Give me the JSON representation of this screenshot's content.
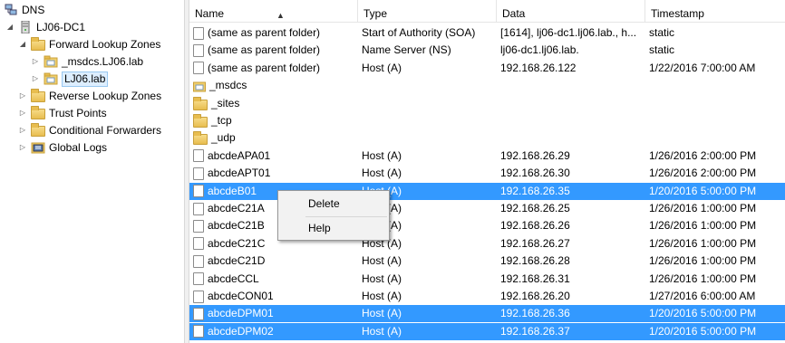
{
  "tree": [
    {
      "label": "DNS",
      "expander": "",
      "icon": "dns-manager-icon"
    },
    {
      "label": "LJ06-DC1",
      "expander": "◢",
      "icon": "server-icon"
    },
    {
      "label": "Forward Lookup Zones",
      "expander": "◢",
      "icon": "folder-icon"
    },
    {
      "label": "_msdcs.LJ06.lab",
      "expander": "▷",
      "icon": "zone-icon"
    },
    {
      "label": "LJ06.lab",
      "expander": "▷",
      "icon": "zone-icon",
      "selected": true
    },
    {
      "label": "Reverse Lookup Zones",
      "expander": "▷",
      "icon": "folder-icon"
    },
    {
      "label": "Trust Points",
      "expander": "▷",
      "icon": "folder-icon"
    },
    {
      "label": "Conditional Forwarders",
      "expander": "▷",
      "icon": "folder-icon"
    },
    {
      "label": "Global Logs",
      "expander": "▷",
      "icon": "log-icon"
    }
  ],
  "columns": {
    "name": "Name",
    "type": "Type",
    "data": "Data",
    "timestamp": "Timestamp"
  },
  "rows": [
    {
      "name": "(same as parent folder)",
      "type": "Start of Authority (SOA)",
      "data": "[1614], lj06-dc1.lj06.lab., h...",
      "timestamp": "static",
      "icon": "record-icon"
    },
    {
      "name": "(same as parent folder)",
      "type": "Name Server (NS)",
      "data": "lj06-dc1.lj06.lab.",
      "timestamp": "static",
      "icon": "record-icon"
    },
    {
      "name": "(same as parent folder)",
      "type": "Host (A)",
      "data": "192.168.26.122",
      "timestamp": "1/22/2016 7:00:00 AM",
      "icon": "record-icon"
    },
    {
      "name": "_msdcs",
      "type": "",
      "data": "",
      "timestamp": "",
      "icon": "zone-icon"
    },
    {
      "name": "_sites",
      "type": "",
      "data": "",
      "timestamp": "",
      "icon": "folder-icon"
    },
    {
      "name": "_tcp",
      "type": "",
      "data": "",
      "timestamp": "",
      "icon": "folder-icon"
    },
    {
      "name": "_udp",
      "type": "",
      "data": "",
      "timestamp": "",
      "icon": "folder-icon"
    },
    {
      "name": "abcdeAPA01",
      "type": "Host (A)",
      "data": "192.168.26.29",
      "timestamp": "1/26/2016 2:00:00 PM",
      "icon": "record-icon"
    },
    {
      "name": "abcdeAPT01",
      "type": "Host (A)",
      "data": "192.168.26.30",
      "timestamp": "1/26/2016 2:00:00 PM",
      "icon": "record-icon"
    },
    {
      "name": "abcdeB01",
      "type": "Host (A)",
      "data": "192.168.26.35",
      "timestamp": "1/20/2016 5:00:00 PM",
      "icon": "record-icon",
      "selected": true
    },
    {
      "name": "abcdeC21A",
      "type": "Host (A)",
      "data": "192.168.26.25",
      "timestamp": "1/26/2016 1:00:00 PM",
      "icon": "record-icon"
    },
    {
      "name": "abcdeC21B",
      "type": "Host (A)",
      "data": "192.168.26.26",
      "timestamp": "1/26/2016 1:00:00 PM",
      "icon": "record-icon"
    },
    {
      "name": "abcdeC21C",
      "type": "Host (A)",
      "data": "192.168.26.27",
      "timestamp": "1/26/2016 1:00:00 PM",
      "icon": "record-icon"
    },
    {
      "name": "abcdeC21D",
      "type": "Host (A)",
      "data": "192.168.26.28",
      "timestamp": "1/26/2016 1:00:00 PM",
      "icon": "record-icon"
    },
    {
      "name": "abcdeCCL",
      "type": "Host (A)",
      "data": "192.168.26.31",
      "timestamp": "1/26/2016 1:00:00 PM",
      "icon": "record-icon"
    },
    {
      "name": "abcdeCON01",
      "type": "Host (A)",
      "data": "192.168.26.20",
      "timestamp": "1/27/2016 6:00:00 AM",
      "icon": "record-icon"
    },
    {
      "name": "abcdeDPM01",
      "type": "Host (A)",
      "data": "192.168.26.36",
      "timestamp": "1/20/2016 5:00:00 PM",
      "icon": "record-icon",
      "selected": true
    },
    {
      "name": "abcdeDPM02",
      "type": "Host (A)",
      "data": "192.168.26.37",
      "timestamp": "1/20/2016 5:00:00 PM",
      "icon": "record-icon",
      "selected": true
    }
  ],
  "context_menu": {
    "delete": "Delete",
    "help": "Help"
  },
  "colors": {
    "selection": "#3399ff",
    "folder": "#e8bd4f",
    "tree_selection": "#ddeeff"
  }
}
